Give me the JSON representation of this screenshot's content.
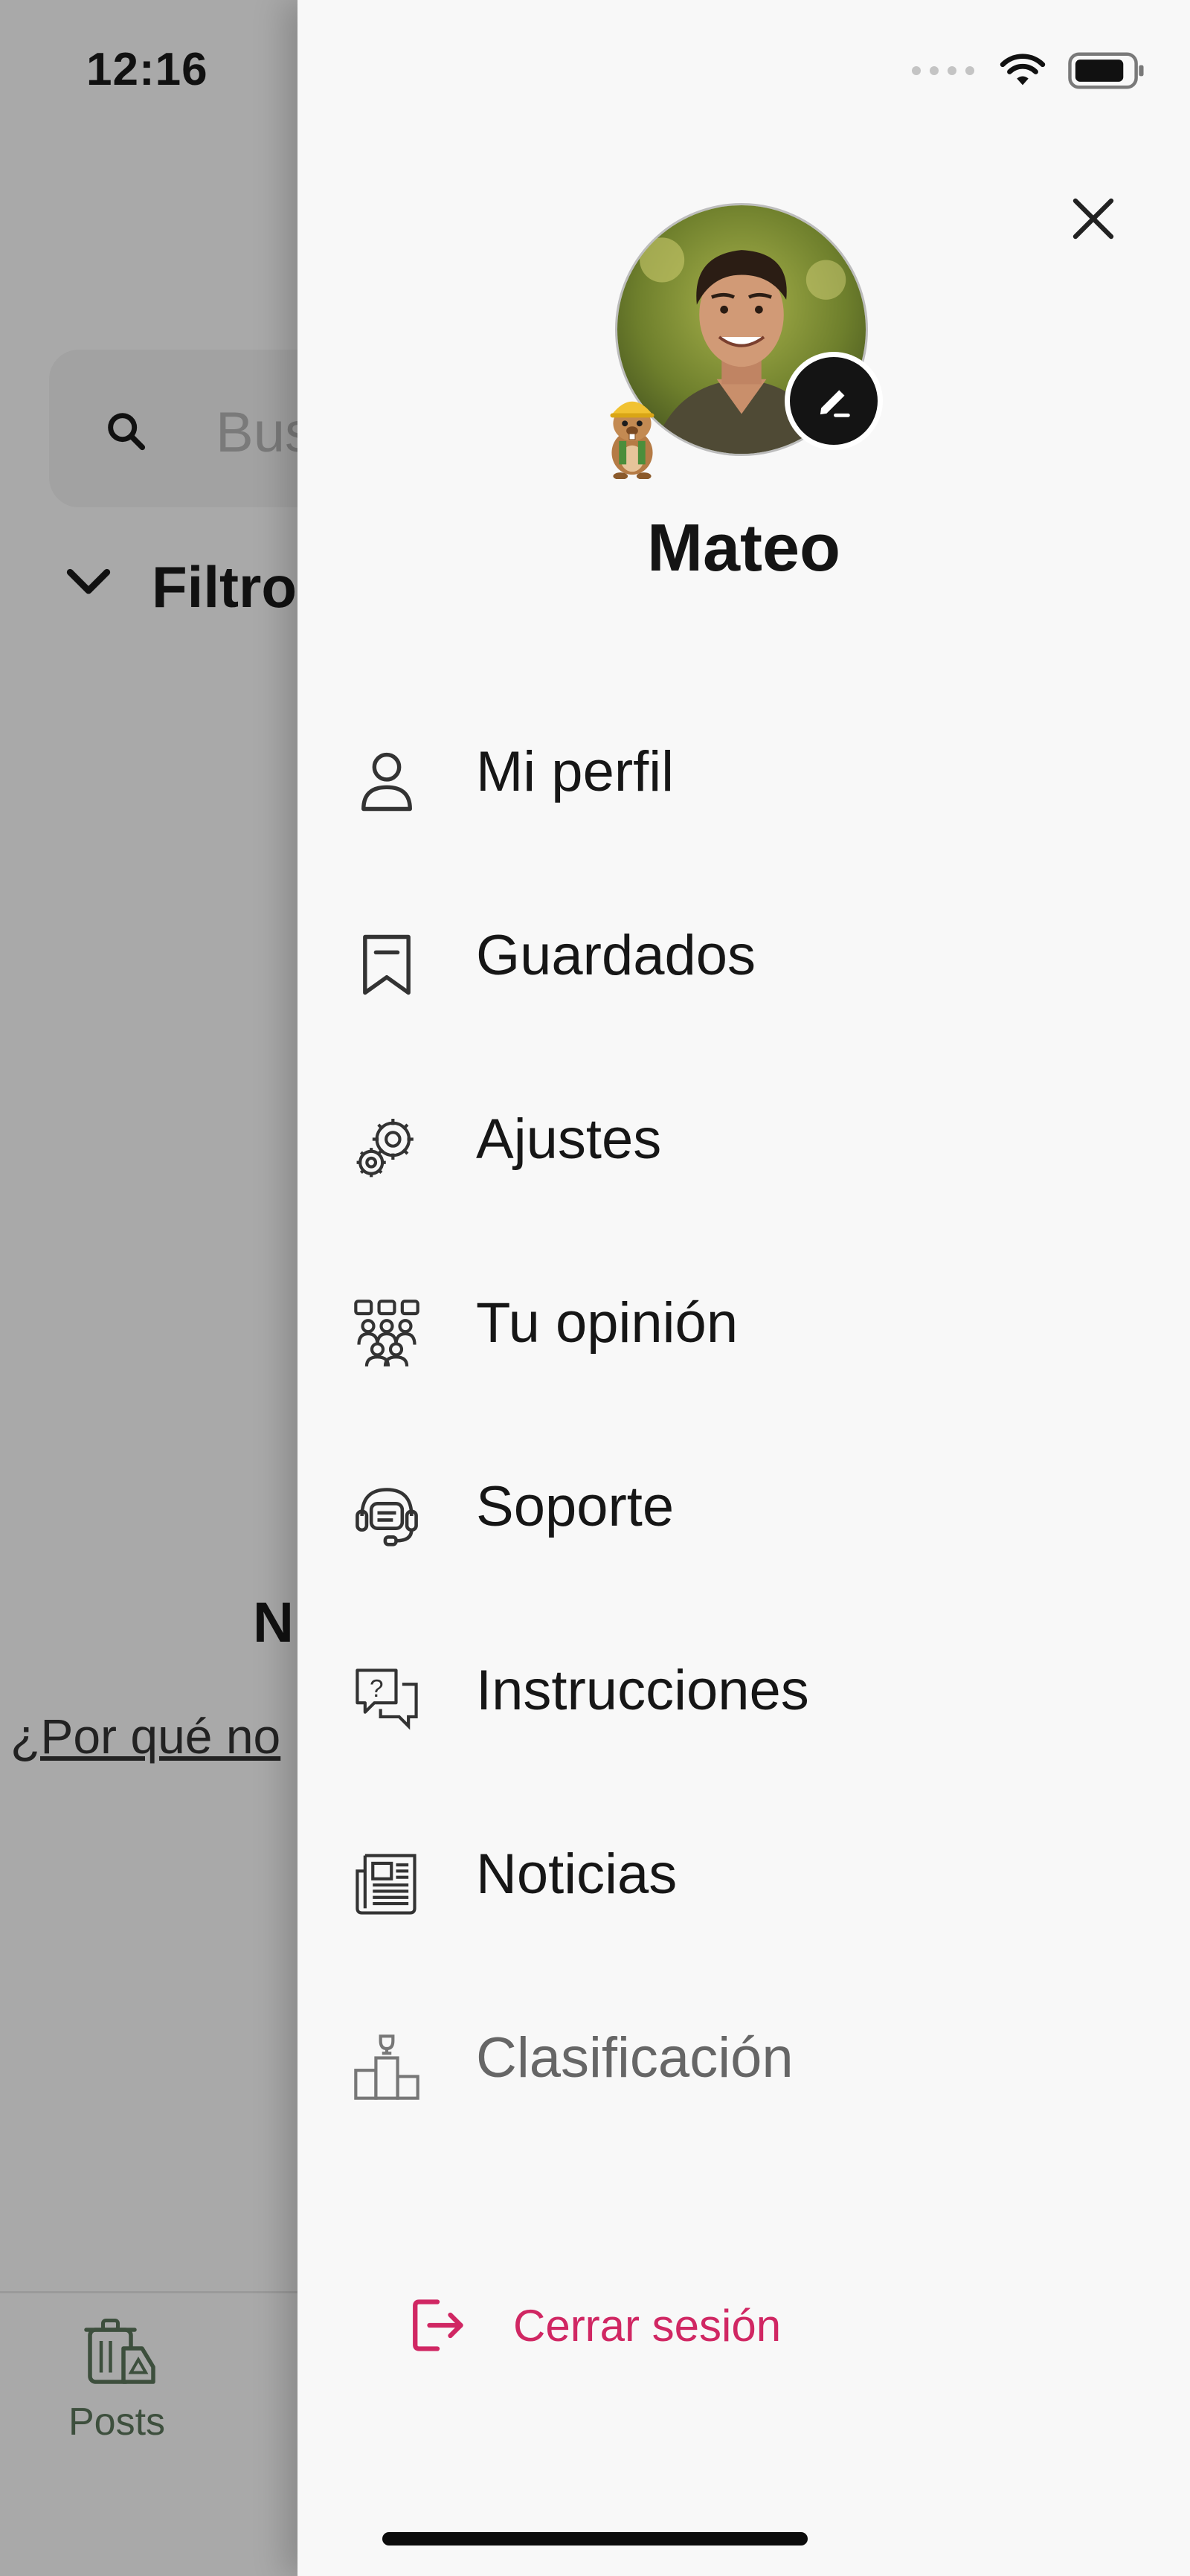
{
  "status_bar": {
    "time": "12:16"
  },
  "background": {
    "search_placeholder": "Bus",
    "filter_label": "Filtro",
    "empty_title": "N",
    "empty_link": "¿Por qué no",
    "nav_posts_label": "Posts"
  },
  "drawer": {
    "user_name": "Mateo",
    "menu": [
      {
        "label": "Mi perfil",
        "icon": "person-icon"
      },
      {
        "label": "Guardados",
        "icon": "bookmark-icon"
      },
      {
        "label": "Ajustes",
        "icon": "gear-icon"
      },
      {
        "label": "Tu opinión",
        "icon": "feedback-group-icon"
      },
      {
        "label": "Soporte",
        "icon": "headset-icon"
      },
      {
        "label": "Instrucciones",
        "icon": "question-chat-icon"
      },
      {
        "label": "Noticias",
        "icon": "newspaper-icon"
      },
      {
        "label": "Clasificación",
        "icon": "podium-icon"
      }
    ],
    "logout_label": "Cerrar sesión"
  },
  "colors": {
    "accent_logout": "#d02763",
    "drawer_bg": "#f8f8f8",
    "overlay_bg": "#a9a9a9"
  }
}
